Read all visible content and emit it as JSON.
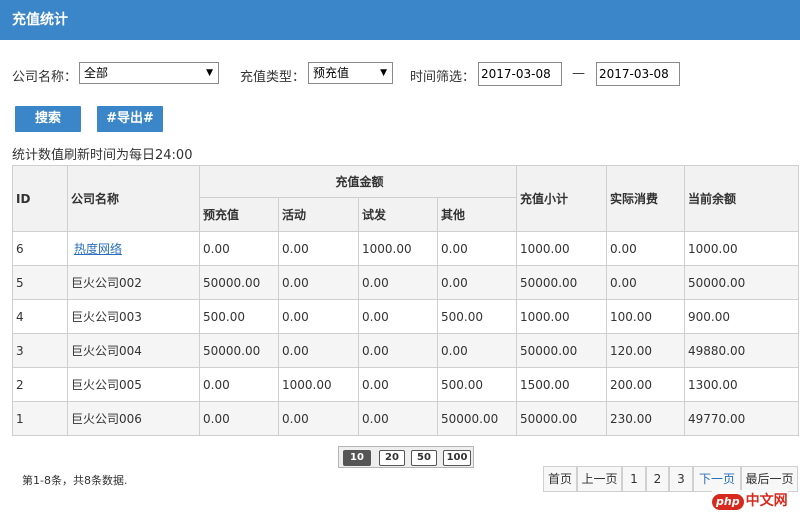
{
  "header": {
    "title": "充值统计"
  },
  "filters": {
    "company_label": "公司名称：",
    "company_value": "全部",
    "type_label": "充值类型：",
    "type_value": "预充值",
    "time_label": "时间筛选：",
    "date_from": "2017-03-08",
    "date_sep": "—",
    "date_to": "2017-03-08"
  },
  "actions": {
    "search": "搜索",
    "export": "#导出#"
  },
  "note": "统计数值刷新时间为每日24:00",
  "table": {
    "headers": {
      "id": "ID",
      "company": "公司名称",
      "amount_group": "充值金额",
      "prepaid": "预充值",
      "activity": "活动",
      "trial": "试发",
      "other": "其他",
      "subtotal": "充值小计",
      "actual": "实际消费",
      "balance": "当前余额"
    },
    "rows": [
      [
        "6",
        "热度网络",
        "0.00",
        "0.00",
        "1000.00",
        "0.00",
        "1000.00",
        "0.00",
        "1000.00"
      ],
      [
        "5",
        "巨火公司002",
        "50000.00",
        "0.00",
        "0.00",
        "0.00",
        "50000.00",
        "0.00",
        "50000.00"
      ],
      [
        "4",
        "巨火公司003",
        "500.00",
        "0.00",
        "0.00",
        "500.00",
        "1000.00",
        "100.00",
        "900.00"
      ],
      [
        "3",
        "巨火公司004",
        "50000.00",
        "0.00",
        "0.00",
        "0.00",
        "50000.00",
        "120.00",
        "49880.00"
      ],
      [
        "2",
        "巨火公司005",
        "0.00",
        "1000.00",
        "0.00",
        "500.00",
        "1500.00",
        "200.00",
        "1300.00"
      ],
      [
        "1",
        "巨火公司006",
        "0.00",
        "0.00",
        "0.00",
        "50000.00",
        "50000.00",
        "230.00",
        "49770.00"
      ]
    ]
  },
  "pagesize": [
    "10",
    "20",
    "50",
    "100"
  ],
  "summary": "第1-8条，共8条数据.",
  "pager": {
    "first": "首页",
    "prev": "上一页",
    "p1": "1",
    "p2": "2",
    "p3": "3",
    "next": "下一页",
    "last": "最后一页"
  },
  "watermark": {
    "badge": "php",
    "text": "中文网"
  }
}
